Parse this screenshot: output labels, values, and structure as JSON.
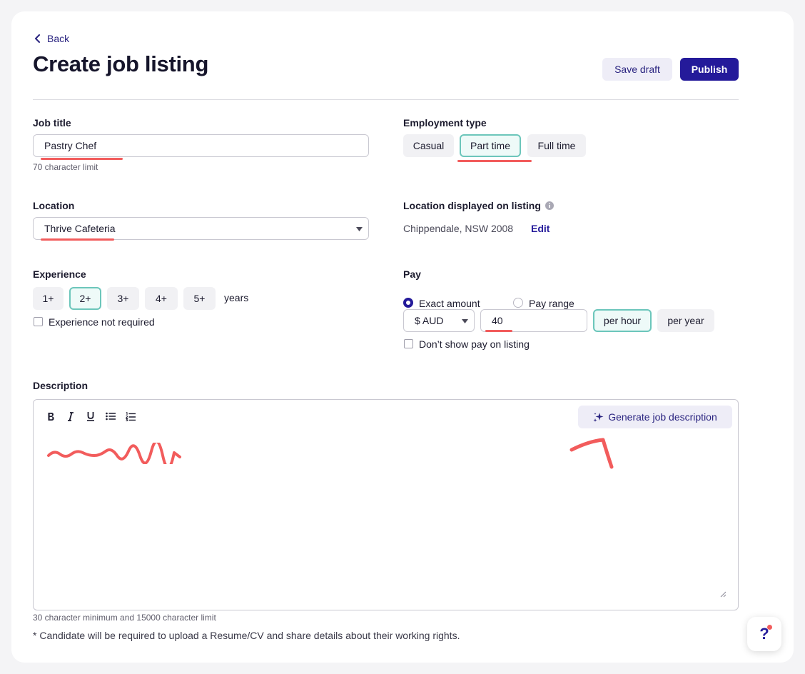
{
  "header": {
    "back_label": "Back",
    "title": "Create job listing",
    "save_draft_label": "Save draft",
    "publish_label": "Publish"
  },
  "job_title": {
    "label": "Job title",
    "value": "Pastry Chef",
    "hint": "70 character limit"
  },
  "employment_type": {
    "label": "Employment type",
    "options": [
      "Casual",
      "Part time",
      "Full time"
    ],
    "selected": "Part time"
  },
  "location": {
    "label": "Location",
    "value": "Thrive Cafeteria"
  },
  "location_displayed": {
    "label": "Location displayed on listing",
    "value": "Chippendale, NSW 2008",
    "edit_label": "Edit"
  },
  "experience": {
    "label": "Experience",
    "options": [
      "1+",
      "2+",
      "3+",
      "4+",
      "5+"
    ],
    "selected": "2+",
    "unit": "years",
    "not_required_label": "Experience not required"
  },
  "pay": {
    "label": "Pay",
    "exact_label": "Exact amount",
    "range_label": "Pay range",
    "currency": "$ AUD",
    "amount": "40",
    "per_hour_label": "per hour",
    "per_year_label": "per year",
    "hide_label": "Don’t show pay on listing"
  },
  "description": {
    "label": "Description",
    "generate_label": "Generate job description",
    "hint": "30 character minimum and 15000 character limit",
    "footnote": "* Candidate will be required to upload a Resume/CV and share details about their working rights."
  },
  "colors": {
    "accent": "#241a9a",
    "selected_border": "#6cc6bb",
    "annotation": "#f25c5c"
  }
}
